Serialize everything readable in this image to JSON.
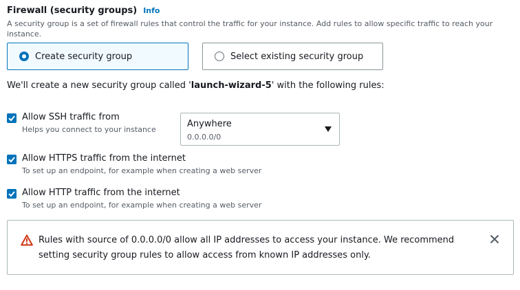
{
  "firewall": {
    "title": "Firewall (security groups)",
    "info_link": "Info",
    "description": "A security group is a set of firewall rules that control the traffic for your instance. Add rules to allow specific traffic to reach your instance."
  },
  "options": {
    "create": "Create security group",
    "select_existing": "Select existing security group",
    "selected": "create"
  },
  "statement": {
    "prefix": "We'll create a new security group called '",
    "group_name": "launch-wizard-5",
    "suffix": "' with the following rules:"
  },
  "rules": {
    "ssh": {
      "label": "Allow SSH traffic from",
      "help": "Helps you connect to your instance",
      "checked": true
    },
    "https": {
      "label": "Allow HTTPS traffic from the internet",
      "help": "To set up an endpoint, for example when creating a web server",
      "checked": true
    },
    "http": {
      "label": "Allow HTTP traffic from the internet",
      "help": "To set up an endpoint, for example when creating a web server",
      "checked": true
    }
  },
  "ssh_source": {
    "value": "Anywhere",
    "sub": "0.0.0.0/0"
  },
  "warning": {
    "text": "Rules with source of 0.0.0.0/0 allow all IP addresses to access your instance. We recommend setting security group rules to allow access from known IP addresses only."
  },
  "colors": {
    "accent": "#0073bb",
    "warning": "#d13212",
    "text": "#16191f",
    "secondary_text": "#545b64"
  }
}
